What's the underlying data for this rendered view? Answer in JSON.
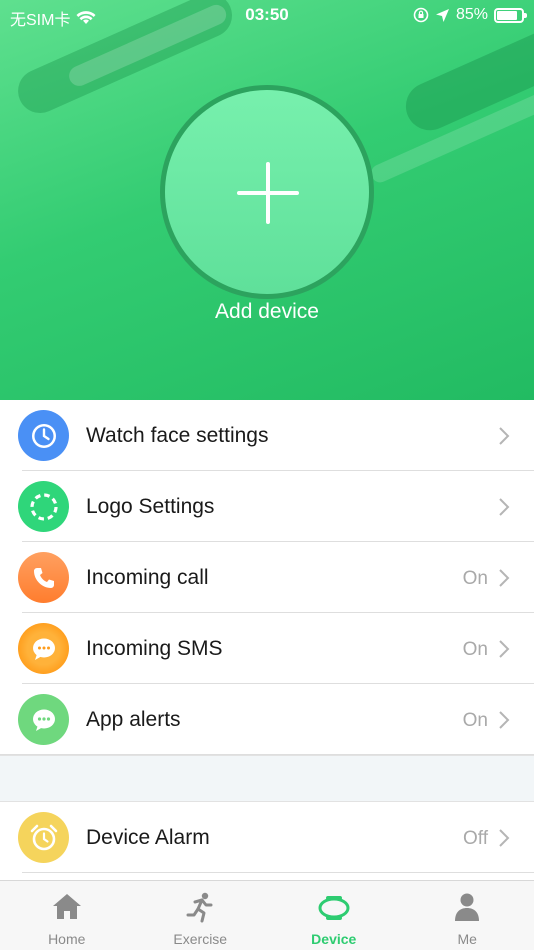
{
  "status_bar": {
    "carrier": "无SIM卡",
    "time": "03:50",
    "battery_percent": "85%",
    "battery_level": 0.85
  },
  "header": {
    "add_device_label": "Add device",
    "colors": {
      "gradient_start": "#5fe08f",
      "gradient_end": "#22bb62"
    }
  },
  "settings": [
    {
      "label": "Watch face settings",
      "value": "",
      "icon": "clock-icon",
      "color": "#4a90f5"
    },
    {
      "label": "Logo Settings",
      "value": "",
      "icon": "dashed-ring-icon",
      "color": "#2fd67a"
    },
    {
      "label": "Incoming call",
      "value": "On",
      "icon": "phone-icon",
      "color": "#ff8a3d"
    },
    {
      "label": "Incoming SMS",
      "value": "On",
      "icon": "message-bubble-icon",
      "color": "#ff9c1a"
    },
    {
      "label": "App alerts",
      "value": "On",
      "icon": "chat-bubble-icon",
      "color": "#6fd87e"
    }
  ],
  "alarm": {
    "label": "Device Alarm",
    "value": "Off",
    "icon": "alarm-clock-icon",
    "color": "#f5d45c"
  },
  "tabs": [
    {
      "label": "Home",
      "icon": "home-icon",
      "active": false
    },
    {
      "label": "Exercise",
      "icon": "running-icon",
      "active": false
    },
    {
      "label": "Device",
      "icon": "watch-icon",
      "active": true
    },
    {
      "label": "Me",
      "icon": "person-icon",
      "active": false
    }
  ],
  "accent": "#2ecc71"
}
